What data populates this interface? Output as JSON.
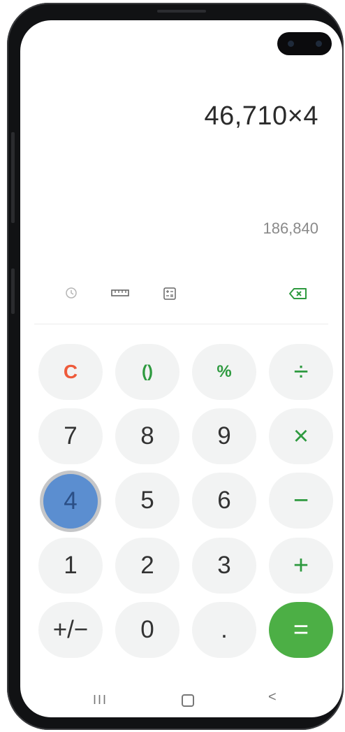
{
  "display": {
    "expression": "46,710×4",
    "result": "186,840"
  },
  "toolbar": {
    "icons": [
      "history-icon",
      "unit-converter-icon",
      "scientific-mode-icon",
      "backspace-icon"
    ],
    "backspace_color": "#2e9a3f"
  },
  "keypad": {
    "rows": [
      [
        {
          "label": "C",
          "kind": "clear"
        },
        {
          "label": "()",
          "kind": "func"
        },
        {
          "label": "%",
          "kind": "func"
        },
        {
          "label": "÷",
          "kind": "op"
        }
      ],
      [
        {
          "label": "7",
          "kind": "digit"
        },
        {
          "label": "8",
          "kind": "digit"
        },
        {
          "label": "9",
          "kind": "digit"
        },
        {
          "label": "×",
          "kind": "op"
        }
      ],
      [
        {
          "label": "4",
          "kind": "digit",
          "pressed": true
        },
        {
          "label": "5",
          "kind": "digit"
        },
        {
          "label": "6",
          "kind": "digit"
        },
        {
          "label": "−",
          "kind": "op"
        }
      ],
      [
        {
          "label": "1",
          "kind": "digit"
        },
        {
          "label": "2",
          "kind": "digit"
        },
        {
          "label": "3",
          "kind": "digit"
        },
        {
          "label": "+",
          "kind": "op"
        }
      ],
      [
        {
          "label": "+/−",
          "kind": "digit"
        },
        {
          "label": "0",
          "kind": "digit"
        },
        {
          "label": ".",
          "kind": "digit"
        },
        {
          "label": "=",
          "kind": "equals"
        }
      ]
    ]
  },
  "navbar": {
    "recent_label": "III",
    "back_label": "<"
  },
  "colors": {
    "accent_green": "#2e9a3f",
    "equals_green": "#4caf45",
    "clear_orange": "#ee5a3a",
    "pressed_blue": "#5b8ed0"
  }
}
